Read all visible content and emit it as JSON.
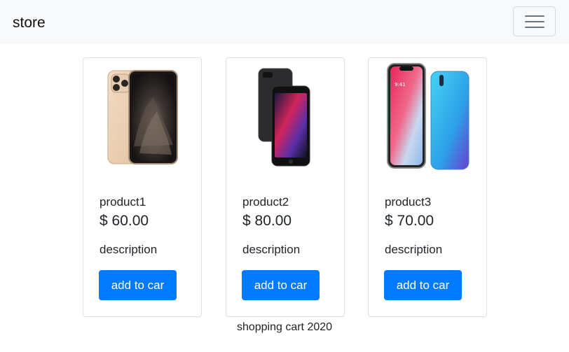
{
  "navbar": {
    "brand": "store",
    "menu_icon": "hamburger-menu-icon"
  },
  "products": [
    {
      "name": "product1",
      "price": "$ 60.00",
      "description": "description",
      "button_label": "add to car",
      "image": "gold-iphone-image"
    },
    {
      "name": "product2",
      "price": "$ 80.00",
      "description": "description",
      "button_label": "add to car",
      "image": "black-iphone-image"
    },
    {
      "name": "product3",
      "price": "$ 70.00",
      "description": "description",
      "button_label": "add to car",
      "image": "iphone-and-blue-phone-image"
    }
  ],
  "footer": {
    "text": "shopping cart 2020"
  },
  "colors": {
    "navbar_bg": "#f8f9fa",
    "button_bg": "#007bff",
    "button_text": "#ffffff",
    "card_border": "#dfdfdf"
  }
}
